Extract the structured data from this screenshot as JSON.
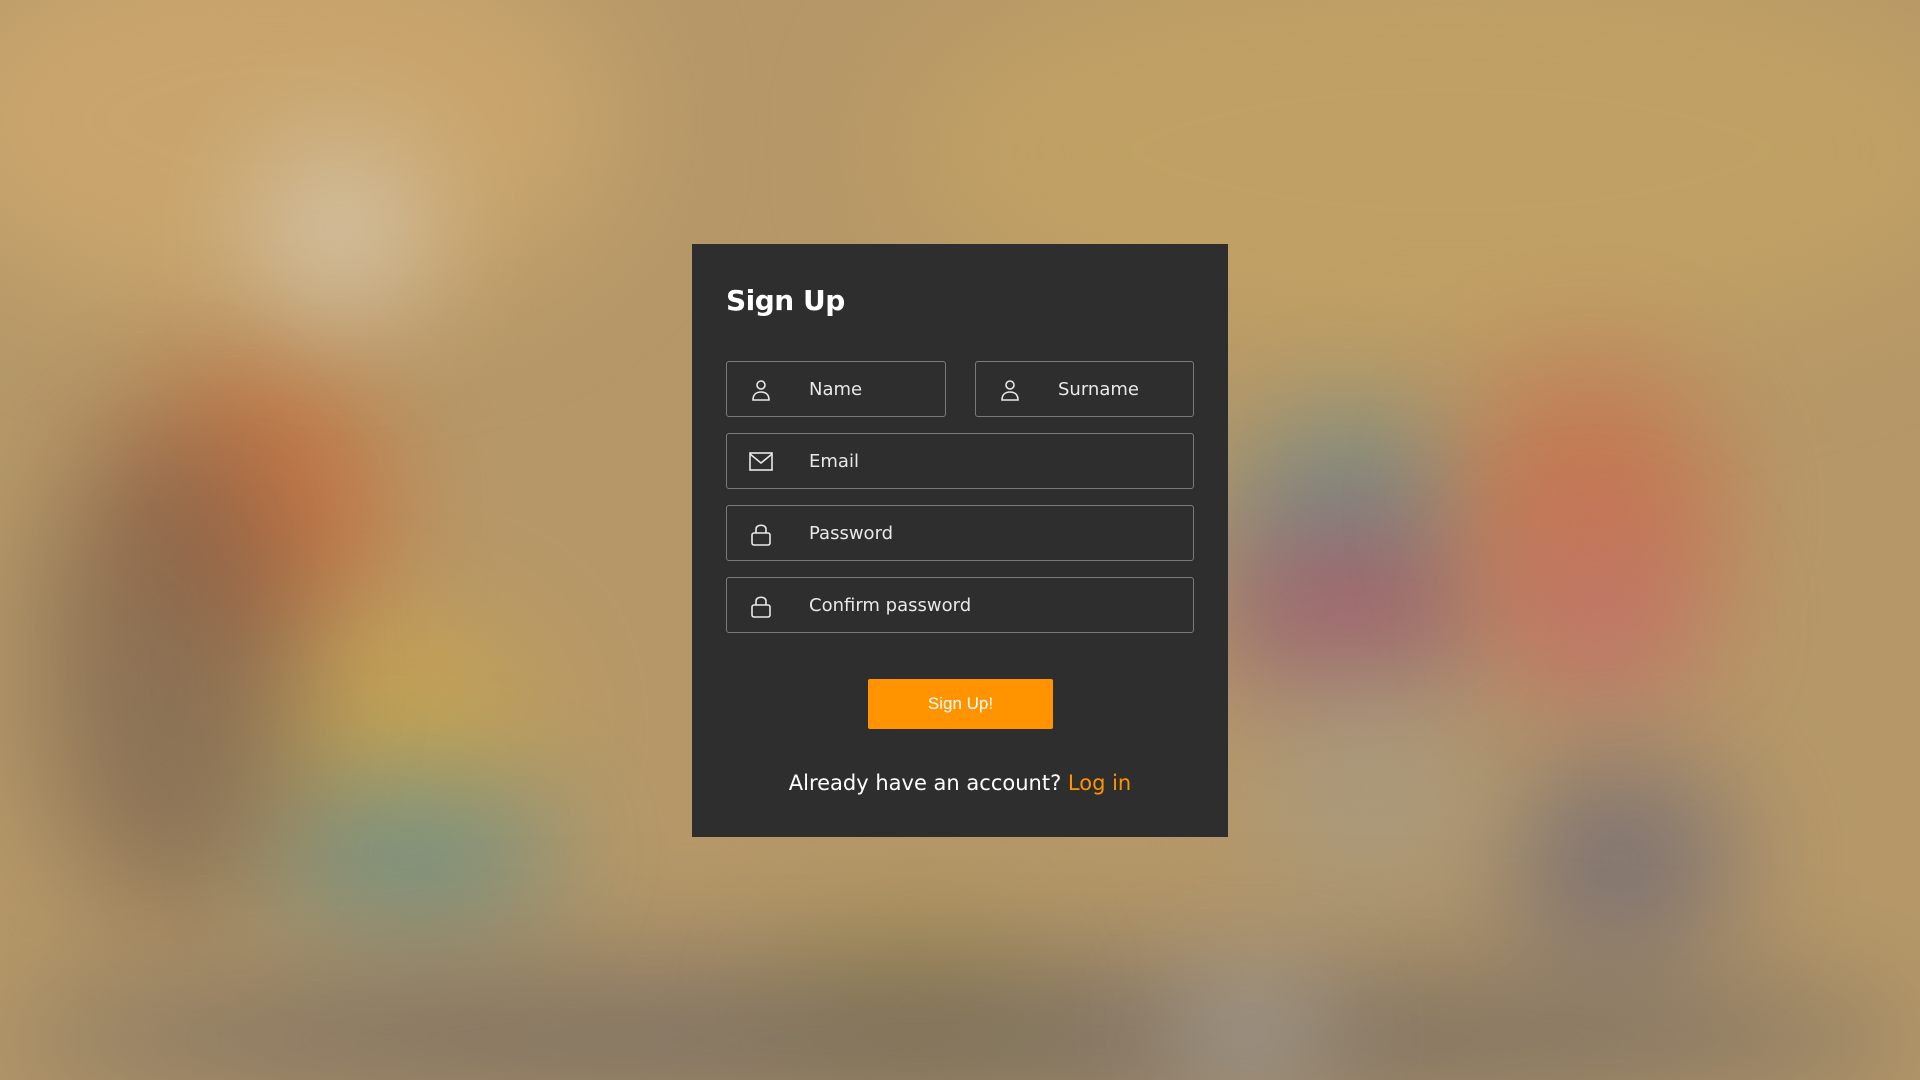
{
  "colors": {
    "card_background": "#2e2e2e",
    "accent": "#ff9400",
    "field_border": "#7a7a7a",
    "text": "#ffffff"
  },
  "form": {
    "title": "Sign Up",
    "fields": {
      "name": {
        "placeholder": "Name",
        "icon": "user-icon"
      },
      "surname": {
        "placeholder": "Surname",
        "icon": "user-icon"
      },
      "email": {
        "placeholder": "Email",
        "icon": "mail-icon"
      },
      "password": {
        "placeholder": "Password",
        "icon": "lock-icon"
      },
      "confirm_password": {
        "placeholder": "Confirm password",
        "icon": "lock-icon"
      }
    },
    "submit_label": "Sign Up!",
    "login_prompt": "Already have an account?",
    "login_link": "Log in"
  }
}
